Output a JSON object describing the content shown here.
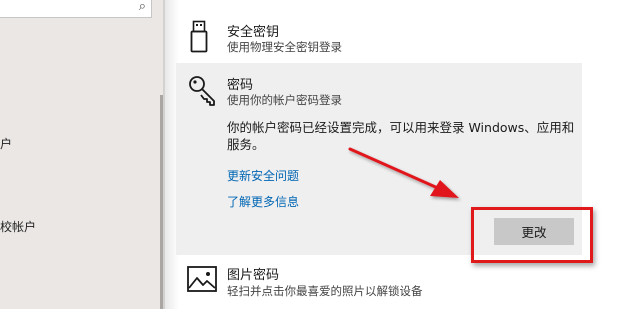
{
  "sidebar": {
    "search_icon": "search-icon",
    "items": [
      {
        "label": "户"
      },
      {
        "label": "校帐户"
      }
    ]
  },
  "options": {
    "security_key": {
      "icon": "usb-key-icon",
      "title": "安全密钥",
      "subtitle": "使用物理安全密钥登录"
    },
    "password": {
      "icon": "key-icon",
      "title": "密码",
      "subtitle": "使用你的帐户密码登录",
      "description": "你的帐户密码已经设置完成，可以用来登录 Windows、应用和服务。",
      "links": [
        {
          "label": "更新安全问题"
        },
        {
          "label": "了解更多信息"
        }
      ],
      "change_button": "更改"
    },
    "picture_password": {
      "icon": "picture-icon",
      "title": "图片密码",
      "subtitle": "轻扫并点击你最喜爱的照片以解锁设备"
    }
  },
  "colors": {
    "link": "#0066b4",
    "annotation": "#e0191b",
    "panel_background": "#efefef",
    "button_background": "#c8c8c8"
  }
}
